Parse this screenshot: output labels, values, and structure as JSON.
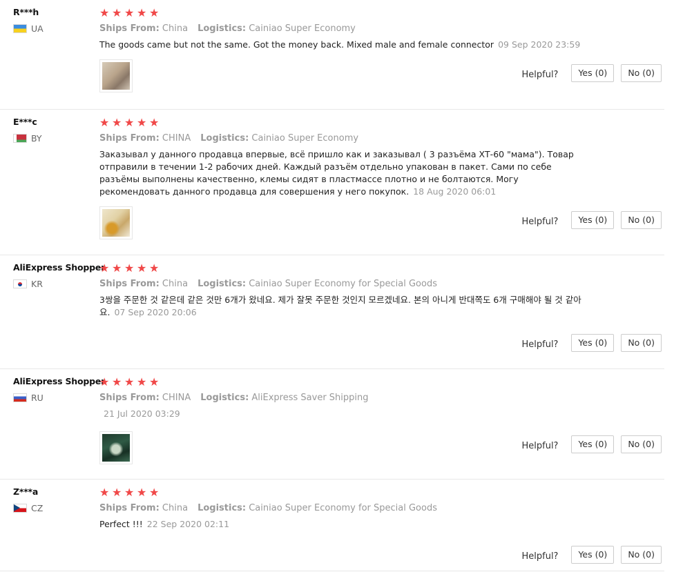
{
  "labels": {
    "ships_from": "Ships From:",
    "logistics": "Logistics:",
    "helpful": "Helpful?",
    "stars": [
      "★",
      "★",
      "★",
      "★",
      "★"
    ]
  },
  "reviews": [
    {
      "username": "R***h",
      "country": "UA",
      "rating": 5,
      "ships_from": "China",
      "logistics": "Cainiao Super Economy",
      "text": "The goods came but not the same. Got the money back. Mixed male and female connector",
      "date": "09 Sep 2020 23:59",
      "has_photo": true,
      "yes": "Yes (0)",
      "no": "No (0)"
    },
    {
      "username": "E***c",
      "country": "BY",
      "rating": 5,
      "ships_from": "CHINA",
      "logistics": "Cainiao Super Economy",
      "text": "Заказывал у данного продавца впервые, всё пришло как и заказывал ( 3 разъёма ХТ-60 \"мама\"). Товар отправили в течении 1-2 рабочих дней. Каждый разъём отдельно упакован в пакет. Сами по себе разъёмы выполнены качественно, клемы сидят в пластмассе плотно и не болтаются. Могу рекомендовать данного продавца для совершения у него покупок.",
      "date": "18 Aug 2020 06:01",
      "has_photo": true,
      "yes": "Yes (0)",
      "no": "No (0)"
    },
    {
      "username": "AliExpress Shopper",
      "country": "KR",
      "rating": 5,
      "ships_from": "China",
      "logistics": "Cainiao Super Economy for Special Goods",
      "text": "3쌍을 주문한 것 같은데 같은 것만 6개가 왔네요. 제가 잘못 주문한 것인지 모르겠네요. 본의 아니게 반대쪽도 6개 구매해야 될 것 같아요.",
      "date": "07 Sep 2020 20:06",
      "has_photo": false,
      "yes": "Yes (0)",
      "no": "No (0)"
    },
    {
      "username": "AliExpress Shopper",
      "country": "RU",
      "rating": 5,
      "ships_from": "CHINA",
      "logistics": "AliExpress Saver Shipping",
      "text": "",
      "date": "21 Jul 2020 03:29",
      "has_photo": true,
      "yes": "Yes (0)",
      "no": "No (0)"
    },
    {
      "username": "Z***a",
      "country": "CZ",
      "rating": 5,
      "ships_from": "China",
      "logistics": "Cainiao Super Economy for Special Goods",
      "text": "Perfect !!!",
      "date": "22 Sep 2020 02:11",
      "has_photo": false,
      "yes": "Yes (0)",
      "no": "No (0)"
    }
  ],
  "colors": {
    "star": "#f04848",
    "meta": "#999999",
    "border": "#e8e8e8"
  }
}
